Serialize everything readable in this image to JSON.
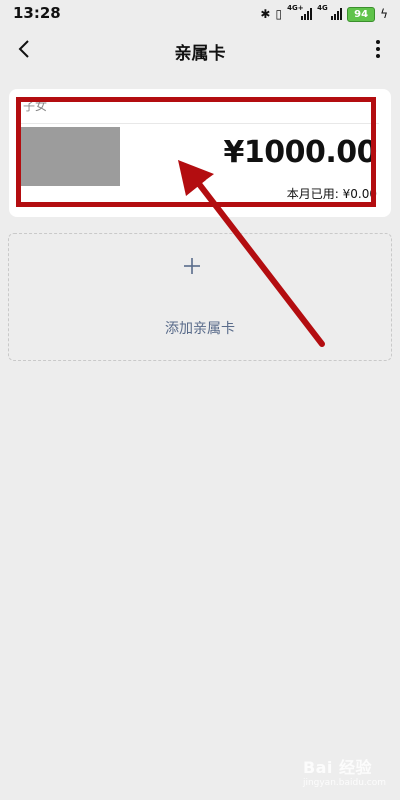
{
  "status_bar": {
    "time": "13:28",
    "net1": "4G+",
    "net2": "4G",
    "battery": "94"
  },
  "nav": {
    "title": "亲属卡"
  },
  "card": {
    "label": "子女",
    "amount": "¥1000.00",
    "used": "本月已用: ¥0.00"
  },
  "add": {
    "label": "添加亲属卡"
  },
  "watermark": {
    "brand": "Bai 经验",
    "url": "jingyan.baidu.com"
  },
  "colors": {
    "background": "#ededed",
    "highlight": "#b30d10",
    "link": "#596b8a",
    "battery": "#5fc34a"
  }
}
